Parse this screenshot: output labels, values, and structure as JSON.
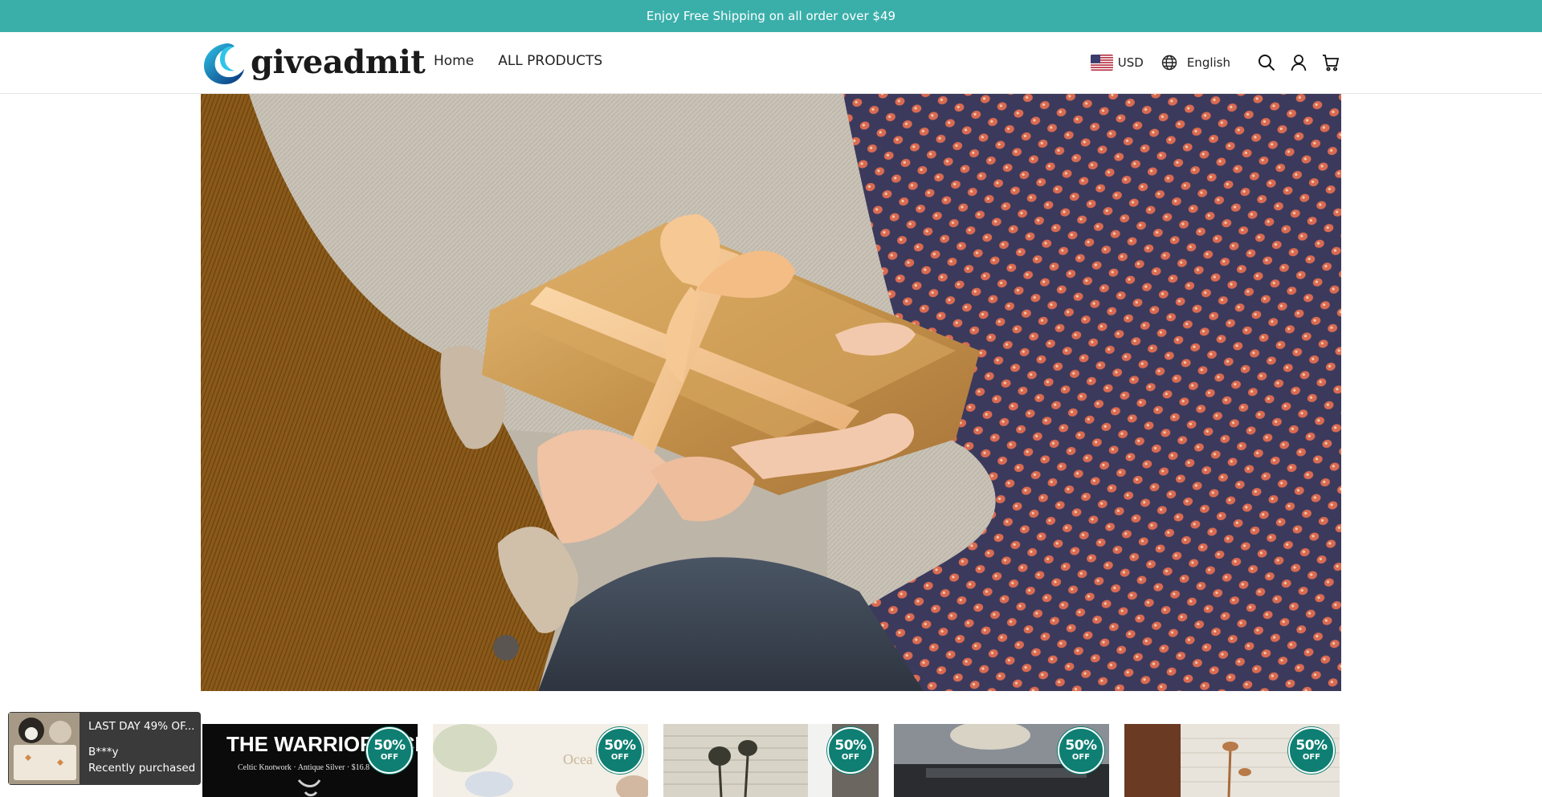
{
  "announcement": {
    "text": "Enjoy Free Shipping on all order over $49"
  },
  "header": {
    "logo_text": "giveadmit",
    "nav": [
      {
        "label": "Home"
      },
      {
        "label": "ALL PRODUCTS"
      }
    ],
    "currency": "USD",
    "language": "English",
    "icons": [
      "globe-icon",
      "search-icon",
      "account-icon",
      "cart-icon"
    ]
  },
  "hero": {
    "alt": "hero-gift-exchange-image"
  },
  "products": [
    {
      "badge_percent": "50%",
      "badge_off": "OFF",
      "title": "THE WARRIOR'S CRO",
      "subtitle": "Celtic Knotwork · Antique Silver · $16.8"
    },
    {
      "badge_percent": "50%",
      "badge_off": "OFF",
      "title": "Ocea"
    },
    {
      "badge_percent": "50%",
      "badge_off": "OFF"
    },
    {
      "badge_percent": "50%",
      "badge_off": "OFF"
    },
    {
      "badge_percent": "50%",
      "badge_off": "OFF"
    }
  ],
  "recent_purchase": {
    "title": "LAST DAY 49% OF...",
    "name": "B***y",
    "status": "Recently purchased"
  },
  "colors": {
    "accent": "#3aafaa",
    "badge": "#0e7f72",
    "popup_bg": "#3a3a3a"
  }
}
